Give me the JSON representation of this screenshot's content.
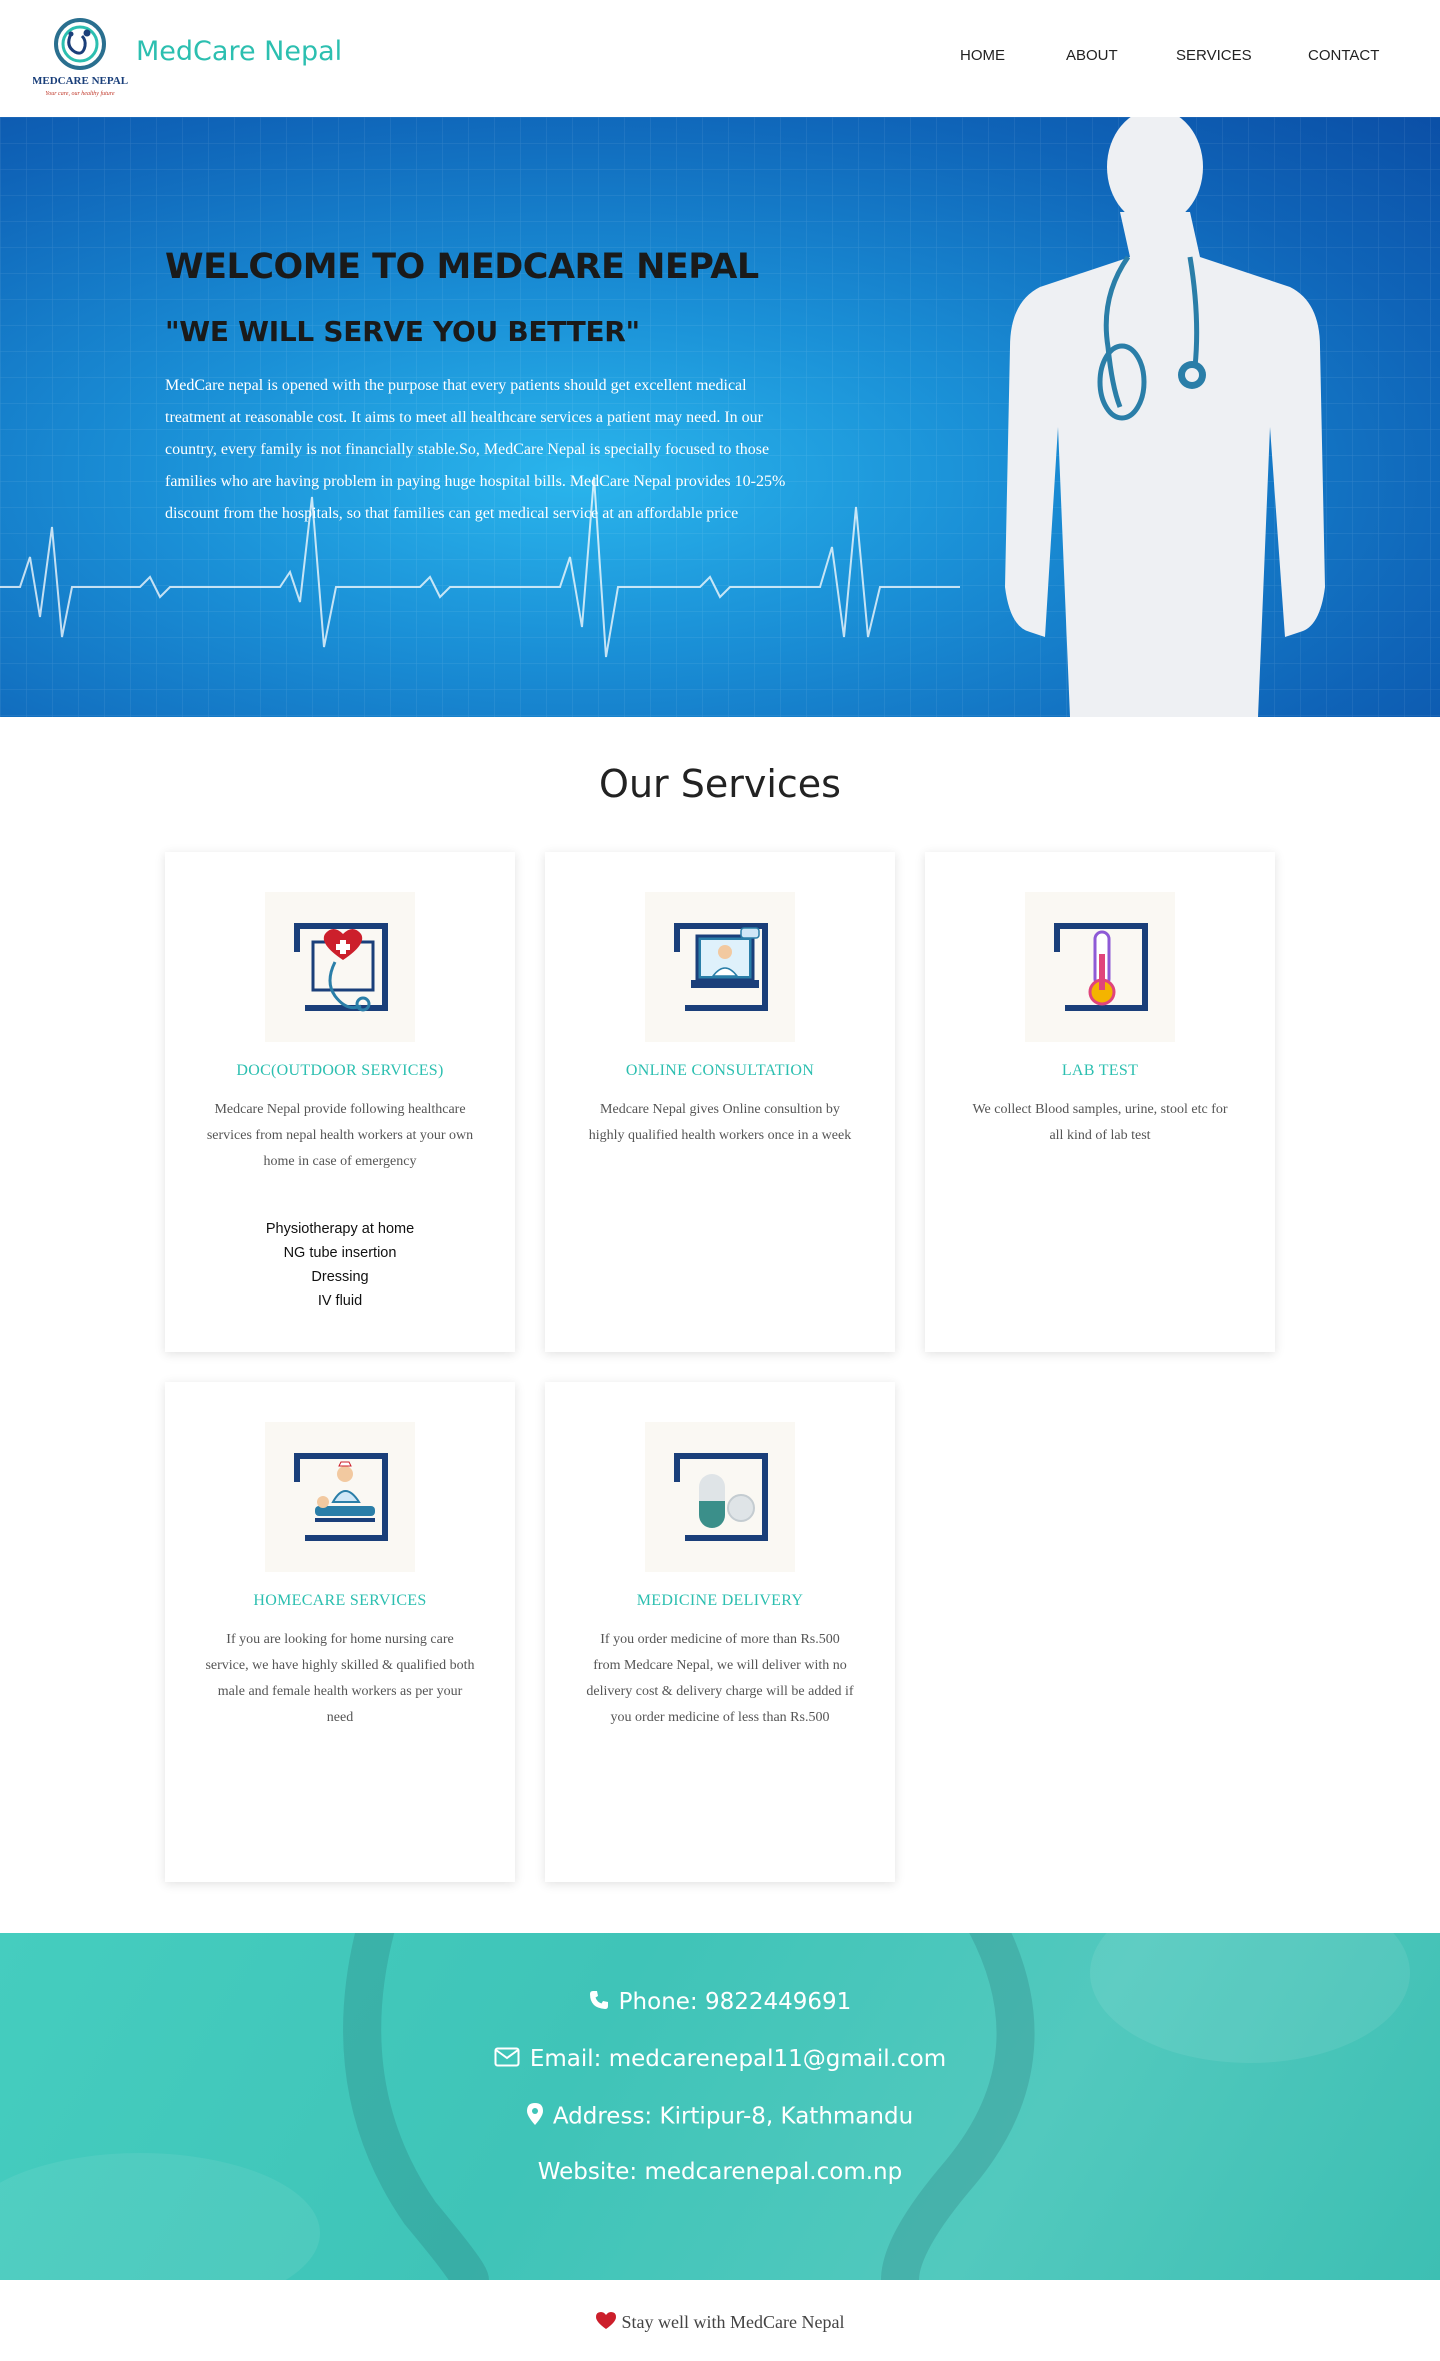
{
  "header": {
    "brand": "MedCare Nepal",
    "logo_text": "MEDCARE NEPAL",
    "logo_tagline": "Your care, our healthy future",
    "nav": [
      "HOME",
      "ABOUT",
      "SERVICES",
      "CONTACT"
    ]
  },
  "hero": {
    "title": "WELCOME TO MEDCARE NEPAL",
    "subtitle": "\"WE WILL SERVE YOU BETTER\"",
    "body": "MedCare nepal is opened with the purpose that every patients should get excellent medical treatment at reasonable cost. It aims to meet all healthcare services a patient may need. In our country, every family is not financially stable.So, MedCare Nepal is specially focused to those families who are having problem in paying huge hospital bills. MedCare Nepal provides 10-25% discount from the hospitals, so that families can get medical service at an affordable price"
  },
  "services": {
    "title": "Our Services",
    "cards": [
      {
        "title": "DOC(OUTDOOR SERVICES)",
        "icon": "heart-stethoscope-icon",
        "desc": "Medcare Nepal provide following healthcare services from nepal health workers at your own home in case of emergency",
        "list": [
          "Physiotherapy at home",
          "NG tube insertion",
          "Dressing",
          "IV fluid"
        ]
      },
      {
        "title": "ONLINE CONSULTATION",
        "icon": "online-doctor-icon",
        "desc": "Medcare Nepal gives Online consultion by highly qualified health workers once in a week"
      },
      {
        "title": "LAB TEST",
        "icon": "thermometer-icon",
        "desc": "We collect Blood samples, urine, stool etc for all kind of lab test"
      },
      {
        "title": "HOMECARE SERVICES",
        "icon": "homecare-nurse-icon",
        "desc": "If you are looking for home nursing care service, we have highly skilled & qualified both male and female health workers as per your need"
      },
      {
        "title": "MEDICINE DELIVERY",
        "icon": "capsule-icon",
        "desc": "If you order medicine of more than Rs.500 from Medcare Nepal, we will deliver with no delivery cost & delivery charge will be added if you order medicine of less than Rs.500"
      }
    ]
  },
  "contact": {
    "phone": "Phone: 9822449691",
    "email": "Email: medcarenepal11@gmail.com",
    "address": "Address: Kirtipur-8, Kathmandu",
    "website": "Website: medcarenepal.com.np"
  },
  "footer": {
    "text": "Stay well with MedCare Nepal"
  },
  "colors": {
    "accent": "#2cbfb0",
    "icon_frame": "#1a3f7a",
    "heart": "#cc1f2b"
  }
}
